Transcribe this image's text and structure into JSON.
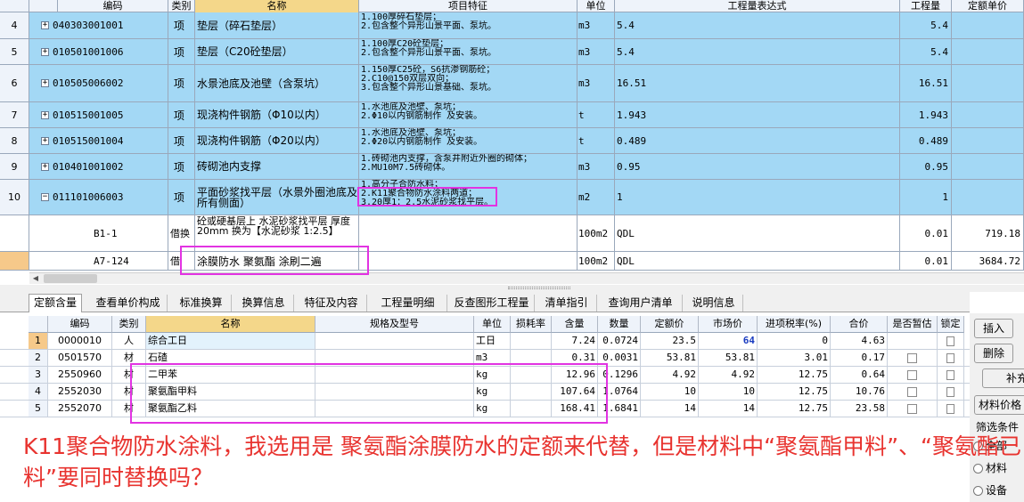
{
  "top_headers": [
    "编码",
    "类别",
    "名称",
    "项目特征",
    "单位",
    "工程量表达式",
    "工程量",
    "定额单价"
  ],
  "top_rows": [
    {
      "no": "4",
      "code": "040303001001",
      "type": "项",
      "name": "垫层（碎石垫层）",
      "feat": "1.100厚碎石垫层；\n2.包含整个异形山景平面、泵坑。",
      "unit": "m3",
      "expr": "5.4",
      "qty": "5.4",
      "price": ""
    },
    {
      "no": "5",
      "code": "010501001006",
      "type": "项",
      "name": "垫层（C20砼垫层）",
      "feat": "1.100厚C20砼垫层；\n2.包含整个异形山景平面、泵坑。",
      "unit": "m3",
      "expr": "5.4",
      "qty": "5.4",
      "price": ""
    },
    {
      "no": "6",
      "code": "010505006002",
      "type": "项",
      "name": "水景池底及池壁（含泵坑）",
      "feat": "1.150厚C25砼，S6抗渗钢筋砼；\n2.C10@150双层双向；\n3.包含整个异形山景基础、泵坑。",
      "unit": "m3",
      "expr": "16.51",
      "qty": "16.51",
      "price": ""
    },
    {
      "no": "7",
      "code": "010515001005",
      "type": "项",
      "name": "现浇构件钢筋（Φ10以内）",
      "feat": "1.水池底及池壁、泵坑；\n2.Φ10以内钢筋制作 及安装。",
      "unit": "t",
      "expr": "1.943",
      "qty": "1.943",
      "price": ""
    },
    {
      "no": "8",
      "code": "010515001004",
      "type": "项",
      "name": "现浇构件钢筋（Φ20以内）",
      "feat": "1.水池底及池壁、泵坑；\n2.Φ20以内钢筋制作 及安装。",
      "unit": "t",
      "expr": "0.489",
      "qty": "0.489",
      "price": ""
    },
    {
      "no": "9",
      "code": "010401001002",
      "type": "项",
      "name": "砖砌池内支撑",
      "feat": "1.砖砌池内支撑，含泵井附近外圈的砌体；\n2.MU10M7.5砖砌体。",
      "unit": "m3",
      "expr": "0.95",
      "qty": "0.95",
      "price": ""
    },
    {
      "no": "10",
      "code": "011101006003",
      "type": "项",
      "name": "平面砂浆找平层（水景外圈池底及所有侧面）",
      "feat": "1.高分子合防水料；\n2.K11聚合物防水涂料两道；\n3.20厚1：2.5水泥砂浆找平层。",
      "unit": "m2",
      "expr": "1",
      "qty": "1",
      "price": ""
    }
  ],
  "sub_rows": [
    {
      "code": "B1-1",
      "type": "借换",
      "name": "砼或硬基层上 水泥砂浆找平层 厚度20mm  换为【水泥砂浆 1:2.5】",
      "unit": "100m2",
      "expr": "QDL",
      "qty": "0.01",
      "price": "719.18"
    },
    {
      "code": "A7-124",
      "type": "借",
      "name": "涂膜防水 聚氨酯 涂刷二遍",
      "unit": "100m2",
      "expr": "QDL",
      "qty": "0.01",
      "price": "3684.72"
    }
  ],
  "tabs": [
    "定额含量",
    "查看单价构成",
    "标准换算",
    "换算信息",
    "特征及内容",
    "工程量明细",
    "反查图形工程量",
    "清单指引",
    "查询用户清单",
    "说明信息"
  ],
  "bottom_headers": [
    "",
    "编码",
    "类别",
    "名称",
    "规格及型号",
    "单位",
    "损耗率",
    "含量",
    "数量",
    "定额价",
    "市场价",
    "进项税率(%)",
    "合价",
    "是否暂估",
    "锁定"
  ],
  "bottom_rows": [
    {
      "no": "1",
      "code": "0000010",
      "type": "人",
      "name": "综合工日",
      "spec": "",
      "unit": "工日",
      "loss": "",
      "content": "7.24",
      "qty": "0.0724",
      "base": "23.5",
      "market": "64",
      "tax": "0",
      "total": "4.63"
    },
    {
      "no": "2",
      "code": "0501570",
      "type": "材",
      "name": "石碴",
      "spec": "",
      "unit": "m3",
      "loss": "",
      "content": "0.31",
      "qty": "0.0031",
      "base": "53.81",
      "market": "53.81",
      "tax": "3.01",
      "total": "0.17"
    },
    {
      "no": "3",
      "code": "2550960",
      "type": "材",
      "name": "二甲苯",
      "spec": "",
      "unit": "kg",
      "loss": "",
      "content": "12.96",
      "qty": "0.1296",
      "base": "4.92",
      "market": "4.92",
      "tax": "12.75",
      "total": "0.64"
    },
    {
      "no": "4",
      "code": "2552030",
      "type": "材",
      "name": "聚氨酯甲料",
      "spec": "",
      "unit": "kg",
      "loss": "",
      "content": "107.64",
      "qty": "1.0764",
      "base": "10",
      "market": "10",
      "tax": "12.75",
      "total": "10.76"
    },
    {
      "no": "5",
      "code": "2552070",
      "type": "材",
      "name": "聚氨酯乙料",
      "spec": "",
      "unit": "kg",
      "loss": "",
      "content": "168.41",
      "qty": "1.6841",
      "base": "14",
      "market": "14",
      "tax": "12.75",
      "total": "23.58"
    }
  ],
  "right_panel": {
    "insert": "插入",
    "delete": "删除",
    "supplement": "补充",
    "material_price": "材料价格",
    "filter_title": "筛选条件",
    "opt_all": "全部",
    "opt_material": "材料",
    "opt_equipment": "设备"
  },
  "question": "K11聚合物防水涂料，我选用是 聚氨酯涂膜防水的定额来代替，但是材料中“聚氨酯甲料”、“聚氨酯已料”要同时替换吗？",
  "colors": {
    "selected_row": "#a3d8f5",
    "highlight": "#e233e2",
    "question": "#e8332f",
    "market_value": "#1a3cc0"
  }
}
